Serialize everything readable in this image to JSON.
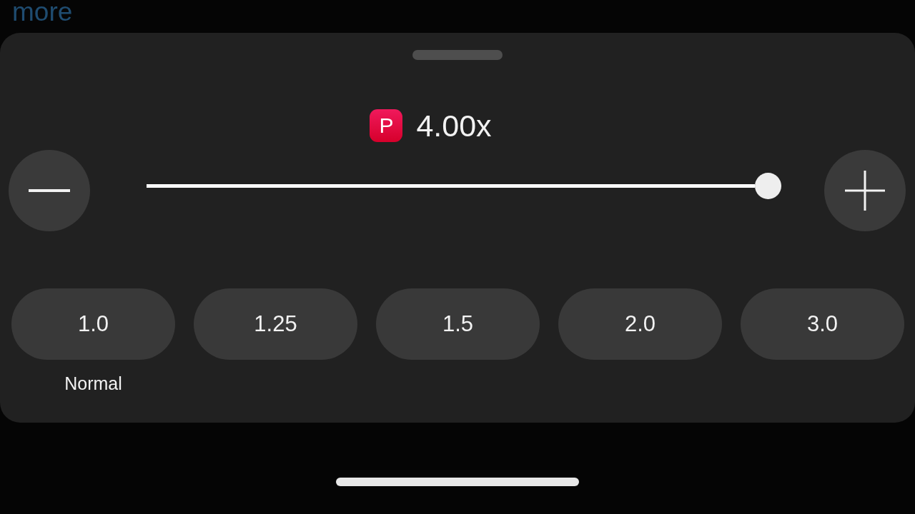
{
  "background": {
    "link": "more"
  },
  "sheet": {
    "badge": "P",
    "speed": "4.00x",
    "slider": {
      "level": 1
    },
    "presets": [
      {
        "label": "1.0",
        "caption": "Normal",
        "selected": false
      },
      {
        "label": "1.25",
        "selected": false
      },
      {
        "label": "1.5",
        "selected": false
      },
      {
        "label": "2.0",
        "selected": false
      },
      {
        "label": "3.0",
        "selected": false
      }
    ]
  }
}
